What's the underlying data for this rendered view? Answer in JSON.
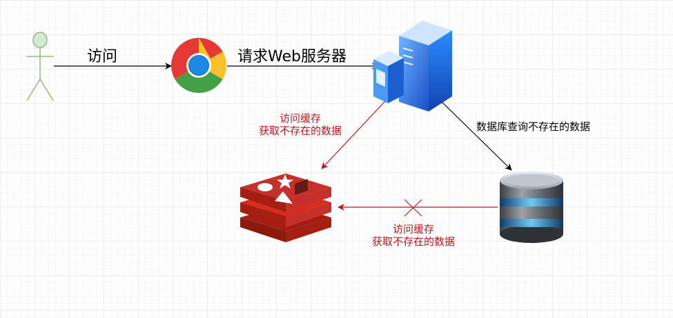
{
  "edges": {
    "visit_label": "访问",
    "request_label": "请求Web服务器",
    "db_query_label": "数据库查询不存在的数据",
    "cache_miss_label_line1": "访问缓存",
    "cache_miss_label_line2": "获取不存在的数据",
    "db_to_cache_label_line1": "访问缓存",
    "db_to_cache_label_line2": "获取不存在的数据"
  },
  "colors": {
    "actor": "#82b366",
    "arrow_black": "#000000",
    "arrow_red": "#c0141b",
    "redis": "#c6302b",
    "server": "#2f7fe3"
  }
}
